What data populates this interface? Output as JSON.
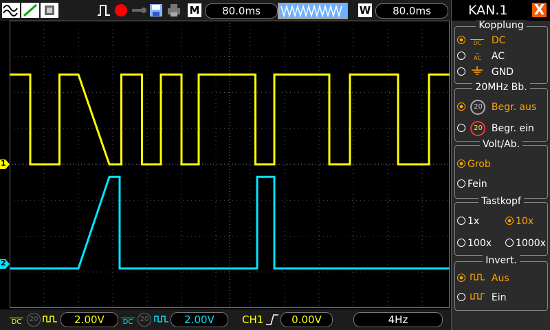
{
  "colors": {
    "ch1": "#ffff00",
    "ch2": "#00e5ff",
    "accent": "#ffa500",
    "close": "#f05a00"
  },
  "top": {
    "m_label": "M",
    "timebase": "80.0ms",
    "w_label": "W",
    "window_timebase": "80.0ms"
  },
  "bottom": {
    "ch1_volts": "2.00V",
    "ch2_volts": "2.00V",
    "trigger_src": "CH1",
    "trigger_level": "0.00V",
    "freq": "4Hz",
    "dc_label": "DC",
    "bw_label": "20"
  },
  "markers": {
    "ch1": "1",
    "ch2": "2"
  },
  "panel": {
    "title": "KAN.1",
    "close": "X",
    "kopplung": {
      "title": "Kopplung",
      "options": [
        "DC",
        "AC",
        "GND"
      ],
      "selected": 0,
      "dc_icon": "DC",
      "ac_icon": "AC"
    },
    "bandwidth": {
      "title": "20MHz  Bb.",
      "options": [
        "Begr.  aus",
        "Begr.  ein"
      ],
      "icon_label": "20",
      "selected": 0
    },
    "voltdiv": {
      "title": "Volt/Ab.",
      "options": [
        "Grob",
        "Fein"
      ],
      "selected": 0
    },
    "tastkopf": {
      "title": "Tastkopf",
      "options": [
        "1x",
        "10x",
        "100x",
        "1000x"
      ],
      "selected": 1
    },
    "invert": {
      "title": "Invert.",
      "options": [
        "Aus",
        "Ein"
      ],
      "selected": 0
    }
  },
  "chart_data": {
    "type": "line",
    "x_unit": "div",
    "y_unit": "div",
    "xlim": [
      0,
      12.8
    ],
    "ylim": [
      -4,
      4
    ],
    "series": [
      {
        "channel": "1",
        "points": [
          [
            0,
            2.5
          ],
          [
            0.6,
            2.5
          ],
          [
            0.6,
            0
          ],
          [
            1.45,
            0
          ],
          [
            1.45,
            2.5
          ],
          [
            2,
            2.5
          ],
          [
            2.9,
            0
          ],
          [
            3.25,
            0
          ],
          [
            3.25,
            2.5
          ],
          [
            3.85,
            2.5
          ],
          [
            3.85,
            0
          ],
          [
            4.4,
            0
          ],
          [
            4.4,
            2.5
          ],
          [
            5,
            2.5
          ],
          [
            5,
            0
          ],
          [
            5.5,
            0
          ],
          [
            5.5,
            2.5
          ],
          [
            7.15,
            2.5
          ],
          [
            7.15,
            0
          ],
          [
            7.7,
            0
          ],
          [
            7.7,
            2.5
          ],
          [
            9.3,
            2.5
          ],
          [
            9.3,
            0
          ],
          [
            9.9,
            0
          ],
          [
            9.9,
            2.5
          ],
          [
            11.3,
            2.5
          ],
          [
            11.3,
            0
          ],
          [
            12.2,
            0
          ],
          [
            12.2,
            2.5
          ],
          [
            12.8,
            2.5
          ]
        ]
      },
      {
        "channel": "2",
        "points": [
          [
            0,
            -2.9
          ],
          [
            2.0,
            -2.9
          ],
          [
            2.9,
            -0.35
          ],
          [
            3.2,
            -0.35
          ],
          [
            3.2,
            -2.9
          ],
          [
            7.2,
            -2.9
          ],
          [
            7.2,
            -0.35
          ],
          [
            7.7,
            -0.35
          ],
          [
            7.7,
            -2.9
          ],
          [
            12.8,
            -2.9
          ]
        ]
      }
    ]
  }
}
